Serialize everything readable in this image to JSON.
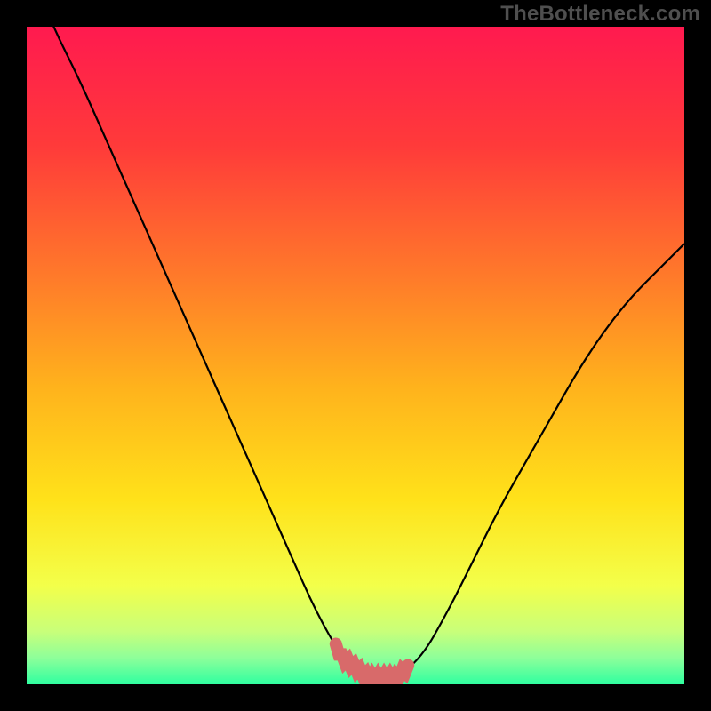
{
  "watermark": "TheBottleneck.com",
  "chart_data": {
    "type": "line",
    "title": "",
    "xlabel": "",
    "ylabel": "",
    "xlim": [
      0,
      100
    ],
    "ylim": [
      0,
      100
    ],
    "x": [
      0,
      4,
      8,
      12,
      16,
      20,
      24,
      28,
      32,
      36,
      40,
      44,
      48,
      52,
      54,
      56,
      60,
      64,
      68,
      72,
      76,
      80,
      84,
      88,
      92,
      96,
      100
    ],
    "values": [
      110,
      100,
      92,
      83,
      74,
      65,
      56,
      47,
      38,
      29,
      20,
      11,
      4,
      1,
      1,
      1,
      4,
      11,
      19,
      27,
      34,
      41,
      48,
      54,
      59,
      63,
      67
    ],
    "marker_band": {
      "x_start": 47,
      "x_end": 58,
      "y": 1
    },
    "gradient_stops": [
      {
        "offset": 0.0,
        "color": "#ff1a4f"
      },
      {
        "offset": 0.18,
        "color": "#ff3a3a"
      },
      {
        "offset": 0.38,
        "color": "#ff7a2a"
      },
      {
        "offset": 0.55,
        "color": "#ffb31c"
      },
      {
        "offset": 0.72,
        "color": "#ffe21a"
      },
      {
        "offset": 0.85,
        "color": "#f3ff4a"
      },
      {
        "offset": 0.92,
        "color": "#c8ff7a"
      },
      {
        "offset": 0.96,
        "color": "#8dff9a"
      },
      {
        "offset": 1.0,
        "color": "#2fffa0"
      }
    ]
  }
}
